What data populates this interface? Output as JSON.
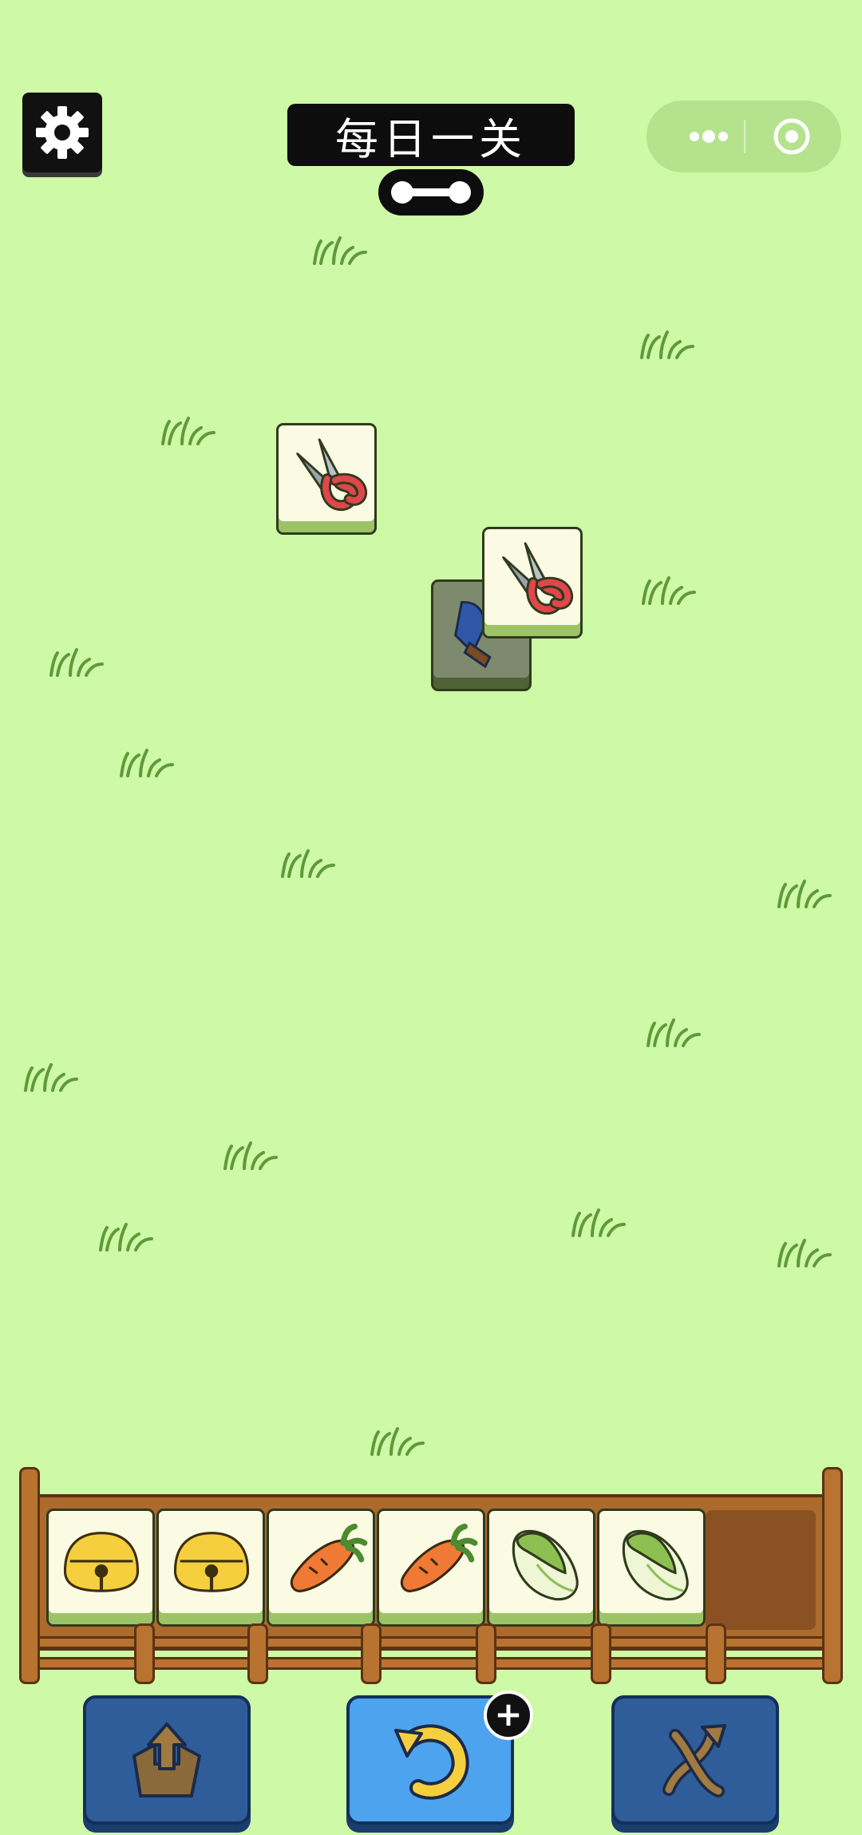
{
  "header": {
    "title": "每日一关"
  },
  "icons": {
    "settings": "gear-icon",
    "more": "more-dots-icon",
    "close": "target-close-icon"
  },
  "board": {
    "tiles": [
      "scissors",
      "scissors",
      "trowel"
    ]
  },
  "tray": {
    "slot_count": 7,
    "items": [
      "bell",
      "bell",
      "carrot",
      "carrot",
      "cabbage",
      "cabbage"
    ]
  },
  "tools": {
    "undo_badge": "+",
    "buttons": [
      "move-out",
      "undo",
      "shuffle"
    ]
  },
  "colors": {
    "background": "#cef9a6",
    "tray_wood": "#ad6a2d",
    "button_blue": "#2f5d99",
    "button_light_blue": "#4ea3ee"
  }
}
